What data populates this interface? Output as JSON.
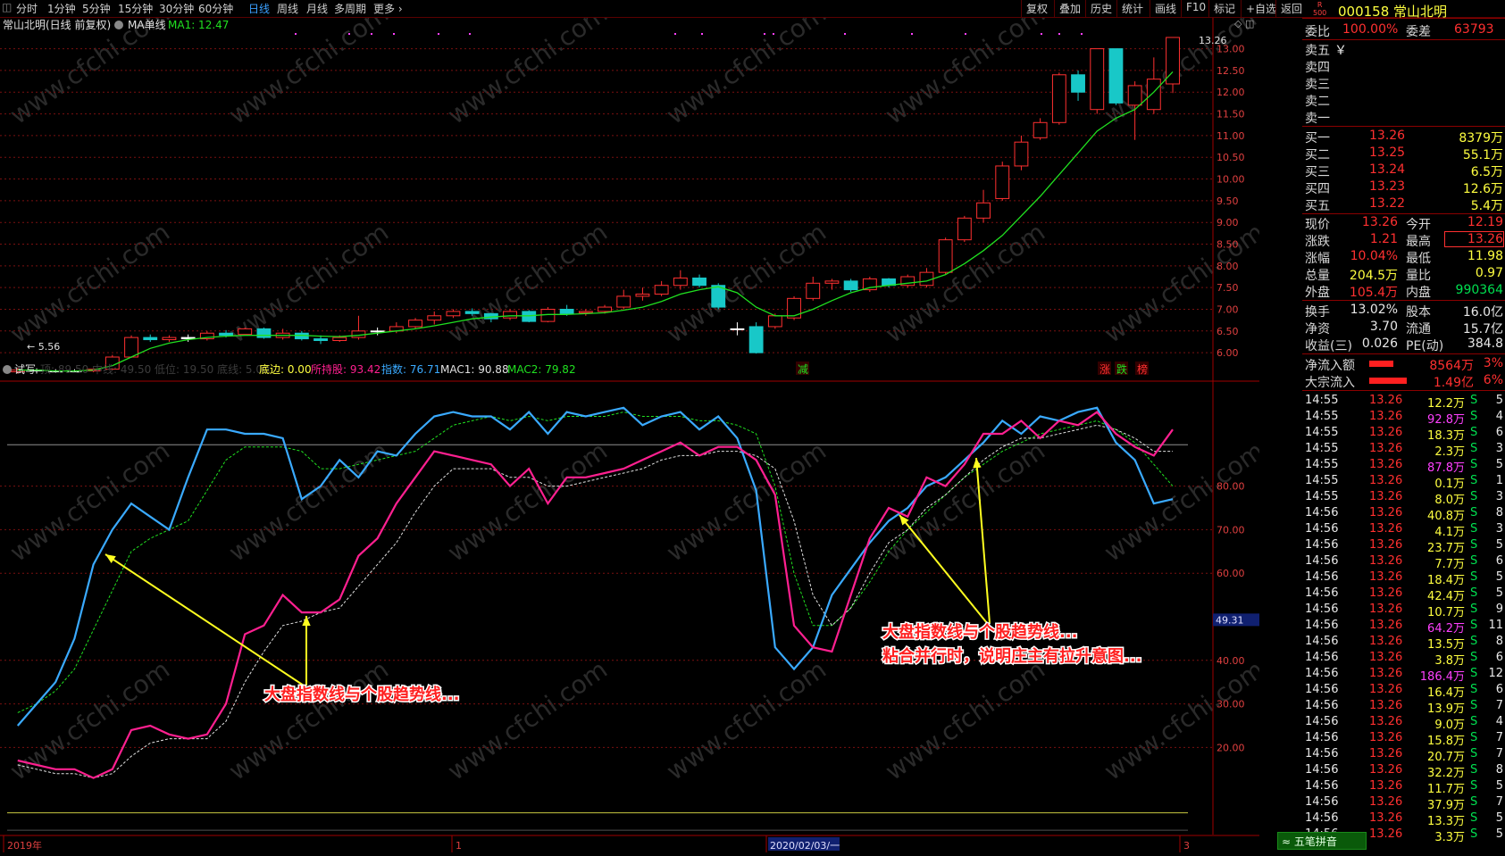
{
  "toolbar": {
    "tabs": [
      "分时",
      "1分钟",
      "5分钟",
      "15分钟",
      "30分钟",
      "60分钟",
      "日线",
      "周线",
      "月线",
      "多周期",
      "更多"
    ],
    "active_tab": "日线",
    "right_buttons": [
      "复权",
      "叠加",
      "历史",
      "统计",
      "画线",
      "F10",
      "标记",
      "+自选",
      "返回"
    ]
  },
  "stock": {
    "code": "000158",
    "name": "常山北明",
    "badge_top": "R",
    "badge_bottom": "500"
  },
  "main_chart": {
    "title": "常山北明(日线 前复权)",
    "indicator_name": "MA单线",
    "ma_label": "MA1: 12.47",
    "high_marker": "13.26",
    "low_marker": "5.56",
    "y_ticks": [
      "13.00",
      "12.50",
      "12.00",
      "11.50",
      "11.00",
      "10.50",
      "10.00",
      "9.50",
      "9.00",
      "8.50",
      "8.00",
      "7.50",
      "7.00",
      "6.50",
      "6.00"
    ],
    "event_labels": [
      "减",
      "涨",
      "跌",
      "榜"
    ]
  },
  "sub_chart": {
    "name": "试写",
    "legend": [
      {
        "label": "底边: 0.00",
        "color": "#ffff40"
      },
      {
        "label": "所持股: 93.42",
        "color": "#ff2090"
      },
      {
        "label": "指数: 76.71",
        "color": "#3aaaff"
      },
      {
        "label": "MAC1: 90.88",
        "color": "#e0e0e0"
      },
      {
        "label": "MAC2: 79.82",
        "color": "#20e020"
      }
    ],
    "faded_legend": "顶: 89.50  中线: 49.50  低位: 19.50  底线: 5.00",
    "y_ticks": [
      "80.00",
      "70.00",
      "60.00",
      "40.00",
      "30.00",
      "20.00"
    ],
    "cursor_value": "49.31",
    "annotation_left": "大盘指数线与个股趋势线...",
    "annotation_right_1": "大盘指数线与个股趋势线...",
    "annotation_right_2": "粘合并行时，说明庄主有拉升意图..."
  },
  "x_axis": {
    "labels": [
      "2019年",
      "1",
      "2020/02/03/一",
      "3"
    ]
  },
  "watermark": "www.cfchi.com",
  "quote": {
    "weibi_label": "委比",
    "weibi_value": "100.00%",
    "weicha_label": "委差",
    "weicha_value": "63793",
    "sell": [
      {
        "label": "卖五",
        "price": "￥",
        "vol": ""
      },
      {
        "label": "卖四",
        "price": "",
        "vol": ""
      },
      {
        "label": "卖三",
        "price": "",
        "vol": ""
      },
      {
        "label": "卖二",
        "price": "",
        "vol": ""
      },
      {
        "label": "卖一",
        "price": "",
        "vol": ""
      }
    ],
    "buy": [
      {
        "label": "买一",
        "price": "13.26",
        "vol": "8379万"
      },
      {
        "label": "买二",
        "price": "13.25",
        "vol": "55.1万"
      },
      {
        "label": "买三",
        "price": "13.24",
        "vol": "6.5万"
      },
      {
        "label": "买四",
        "price": "13.23",
        "vol": "12.6万"
      },
      {
        "label": "买五",
        "price": "13.22",
        "vol": "5.4万"
      }
    ],
    "stats": [
      {
        "l1": "现价",
        "v1": "13.26",
        "c1": "red",
        "l2": "今开",
        "v2": "12.19",
        "c2": "red"
      },
      {
        "l1": "涨跌",
        "v1": "1.21",
        "c1": "red",
        "l2": "最高",
        "v2": "13.26",
        "c2": "red"
      },
      {
        "l1": "涨幅",
        "v1": "10.04%",
        "c1": "red",
        "l2": "最低",
        "v2": "11.98",
        "c2": "yel"
      },
      {
        "l1": "总量",
        "v1": "204.5万",
        "c1": "yel",
        "l2": "量比",
        "v2": "0.97",
        "c2": "yel"
      },
      {
        "l1": "外盘",
        "v1": "105.4万",
        "c1": "red",
        "l2": "内盘",
        "v2": "990364",
        "c2": "grn"
      }
    ],
    "fund": [
      {
        "l1": "换手",
        "v1": "13.02%",
        "l2": "股本",
        "v2": "16.0亿"
      },
      {
        "l1": "净资",
        "v1": "3.70",
        "l2": "流通",
        "v2": "15.7亿"
      },
      {
        "l1": "收益(三)",
        "v1": "0.026",
        "l2": "PE(动)",
        "v2": "384.8"
      }
    ],
    "flow": [
      {
        "label": "净流入额",
        "value": "8564万",
        "pct": "3%"
      },
      {
        "label": "大宗流入",
        "value": "1.49亿",
        "pct": "6%"
      }
    ]
  },
  "ticks": [
    {
      "t": "14:55",
      "p": "13.26",
      "v": "12.2万",
      "s": "S",
      "n": "5"
    },
    {
      "t": "14:55",
      "p": "13.26",
      "v": "92.8万",
      "s": "S",
      "n": "4"
    },
    {
      "t": "14:55",
      "p": "13.26",
      "v": "18.3万",
      "s": "S",
      "n": "6"
    },
    {
      "t": "14:55",
      "p": "13.26",
      "v": "2.3万",
      "s": "S",
      "n": "3"
    },
    {
      "t": "14:55",
      "p": "13.26",
      "v": "87.8万",
      "s": "S",
      "n": "5"
    },
    {
      "t": "14:55",
      "p": "13.26",
      "v": "0.1万",
      "s": "S",
      "n": "1"
    },
    {
      "t": "14:55",
      "p": "13.26",
      "v": "8.0万",
      "s": "S",
      "n": "3"
    },
    {
      "t": "14:56",
      "p": "13.26",
      "v": "40.8万",
      "s": "S",
      "n": "8"
    },
    {
      "t": "14:56",
      "p": "13.26",
      "v": "4.1万",
      "s": "S",
      "n": "3"
    },
    {
      "t": "14:56",
      "p": "13.26",
      "v": "23.7万",
      "s": "S",
      "n": "5"
    },
    {
      "t": "14:56",
      "p": "13.26",
      "v": "7.7万",
      "s": "S",
      "n": "6"
    },
    {
      "t": "14:56",
      "p": "13.26",
      "v": "18.4万",
      "s": "S",
      "n": "5"
    },
    {
      "t": "14:56",
      "p": "13.26",
      "v": "42.4万",
      "s": "S",
      "n": "5"
    },
    {
      "t": "14:56",
      "p": "13.26",
      "v": "10.7万",
      "s": "S",
      "n": "9"
    },
    {
      "t": "14:56",
      "p": "13.26",
      "v": "64.2万",
      "s": "S",
      "n": "11"
    },
    {
      "t": "14:56",
      "p": "13.26",
      "v": "13.5万",
      "s": "S",
      "n": "8"
    },
    {
      "t": "14:56",
      "p": "13.26",
      "v": "3.8万",
      "s": "S",
      "n": "6"
    },
    {
      "t": "14:56",
      "p": "13.26",
      "v": "186.4万",
      "s": "S",
      "n": "12"
    },
    {
      "t": "14:56",
      "p": "13.26",
      "v": "16.4万",
      "s": "S",
      "n": "6"
    },
    {
      "t": "14:56",
      "p": "13.26",
      "v": "13.9万",
      "s": "S",
      "n": "7"
    },
    {
      "t": "14:56",
      "p": "13.26",
      "v": "9.0万",
      "s": "S",
      "n": "4"
    },
    {
      "t": "14:56",
      "p": "13.26",
      "v": "15.8万",
      "s": "S",
      "n": "7"
    },
    {
      "t": "14:56",
      "p": "13.26",
      "v": "20.7万",
      "s": "S",
      "n": "7"
    },
    {
      "t": "14:56",
      "p": "13.26",
      "v": "32.2万",
      "s": "S",
      "n": "8"
    },
    {
      "t": "14:56",
      "p": "13.26",
      "v": "11.7万",
      "s": "S",
      "n": "5"
    },
    {
      "t": "14:56",
      "p": "13.26",
      "v": "37.9万",
      "s": "S",
      "n": "7"
    },
    {
      "t": "14:56",
      "p": "13.26",
      "v": "13.3万",
      "s": "S",
      "n": "5"
    },
    {
      "t": "14:56",
      "p": "13.26",
      "v": "3.3万",
      "s": "S",
      "n": "5"
    }
  ],
  "bottom_button": "五笔拼音",
  "chart_data": {
    "type": "candlestick",
    "price_ylim": [
      5.9,
      13.3
    ],
    "candles": [
      [
        5.56,
        5.6,
        5.52,
        5.65
      ],
      [
        5.6,
        5.58,
        5.52,
        5.64
      ],
      [
        5.58,
        5.58,
        5.54,
        5.62
      ],
      [
        5.58,
        5.58,
        5.55,
        5.62
      ],
      [
        5.58,
        5.62,
        5.55,
        5.65
      ],
      [
        5.62,
        5.9,
        5.6,
        5.95
      ],
      [
        5.9,
        6.35,
        5.88,
        6.4
      ],
      [
        6.35,
        6.3,
        6.25,
        6.42
      ],
      [
        6.3,
        6.35,
        6.25,
        6.4
      ],
      [
        6.35,
        6.32,
        6.25,
        6.42
      ],
      [
        6.32,
        6.45,
        6.28,
        6.5
      ],
      [
        6.45,
        6.4,
        6.35,
        6.52
      ],
      [
        6.42,
        6.55,
        6.4,
        6.58
      ],
      [
        6.55,
        6.35,
        6.32,
        6.58
      ],
      [
        6.35,
        6.45,
        6.3,
        6.55
      ],
      [
        6.45,
        6.32,
        6.28,
        6.5
      ],
      [
        6.32,
        6.28,
        6.2,
        6.4
      ],
      [
        6.28,
        6.35,
        6.25,
        6.4
      ],
      [
        6.35,
        6.5,
        6.3,
        6.85
      ],
      [
        6.5,
        6.5,
        6.4,
        6.58
      ],
      [
        6.5,
        6.6,
        6.45,
        6.7
      ],
      [
        6.6,
        6.75,
        6.55,
        6.8
      ],
      [
        6.75,
        6.85,
        6.65,
        6.95
      ],
      [
        6.85,
        6.95,
        6.8,
        7.0
      ],
      [
        6.95,
        6.9,
        6.85,
        7.02
      ],
      [
        6.9,
        6.78,
        6.7,
        6.92
      ],
      [
        6.8,
        6.95,
        6.75,
        7.0
      ],
      [
        6.95,
        6.72,
        6.7,
        6.98
      ],
      [
        6.72,
        7.0,
        6.7,
        7.05
      ],
      [
        7.0,
        6.9,
        6.85,
        7.1
      ],
      [
        6.92,
        6.95,
        6.85,
        7.0
      ],
      [
        6.95,
        7.05,
        6.9,
        7.1
      ],
      [
        7.05,
        7.3,
        7.0,
        7.45
      ],
      [
        7.3,
        7.35,
        7.2,
        7.5
      ],
      [
        7.35,
        7.55,
        7.3,
        7.65
      ],
      [
        7.55,
        7.72,
        7.45,
        7.9
      ],
      [
        7.72,
        7.55,
        7.5,
        7.8
      ],
      [
        7.55,
        7.05,
        7.0,
        7.6
      ],
      [
        6.55,
        6.55,
        6.4,
        6.7
      ],
      [
        6.6,
        6.0,
        5.98,
        6.7
      ],
      [
        6.6,
        6.85,
        6.55,
        6.9
      ],
      [
        6.8,
        7.25,
        6.75,
        7.3
      ],
      [
        7.25,
        7.6,
        7.2,
        7.75
      ],
      [
        7.6,
        7.65,
        7.45,
        7.7
      ],
      [
        7.65,
        7.45,
        7.4,
        7.7
      ],
      [
        7.45,
        7.7,
        7.4,
        7.75
      ],
      [
        7.7,
        7.55,
        7.5,
        7.72
      ],
      [
        7.55,
        7.75,
        7.5,
        7.8
      ],
      [
        7.55,
        7.85,
        7.5,
        7.95
      ],
      [
        7.85,
        8.6,
        7.8,
        8.65
      ],
      [
        8.6,
        9.1,
        8.55,
        9.15
      ],
      [
        9.1,
        9.45,
        9.0,
        9.75
      ],
      [
        9.55,
        10.3,
        9.5,
        10.4
      ],
      [
        10.3,
        10.85,
        10.2,
        11.0
      ],
      [
        10.95,
        11.3,
        10.9,
        11.4
      ],
      [
        11.3,
        12.4,
        11.25,
        12.45
      ],
      [
        12.4,
        12.0,
        11.8,
        12.5
      ],
      [
        11.6,
        13.0,
        11.5,
        13.0
      ],
      [
        13.0,
        11.75,
        11.7,
        13.0
      ],
      [
        11.7,
        12.15,
        10.9,
        12.25
      ],
      [
        11.6,
        12.3,
        11.5,
        12.8
      ],
      [
        12.19,
        13.26,
        11.98,
        13.26
      ]
    ],
    "ma": [
      5.6,
      5.6,
      5.58,
      5.58,
      5.6,
      5.7,
      5.9,
      6.1,
      6.22,
      6.3,
      6.35,
      6.38,
      6.4,
      6.4,
      6.4,
      6.4,
      6.38,
      6.37,
      6.4,
      6.45,
      6.5,
      6.55,
      6.62,
      6.7,
      6.78,
      6.82,
      6.85,
      6.85,
      6.88,
      6.88,
      6.9,
      6.92,
      6.98,
      7.05,
      7.18,
      7.35,
      7.45,
      7.52,
      7.38,
      7.05,
      6.85,
      6.85,
      7.0,
      7.2,
      7.38,
      7.5,
      7.55,
      7.6,
      7.65,
      7.8,
      8.05,
      8.35,
      8.7,
      9.15,
      9.6,
      10.1,
      10.6,
      11.1,
      11.4,
      11.6,
      12.0,
      12.47
    ],
    "sub_ylim": [
      0,
      100
    ],
    "stock_line": [
      17,
      16,
      15,
      15,
      13,
      15,
      24,
      25,
      23,
      22,
      23,
      30,
      46,
      48,
      55,
      51,
      51,
      54,
      64,
      68,
      76,
      82,
      88,
      87,
      86,
      85,
      80,
      84,
      76,
      82,
      82,
      83,
      84,
      86,
      88,
      90,
      87,
      89,
      89,
      86,
      78,
      48,
      43,
      42,
      55,
      68,
      75,
      73,
      82,
      80,
      85,
      92,
      92,
      95,
      91,
      95,
      94,
      97,
      92,
      89,
      87,
      93
    ],
    "index_line": [
      25,
      30,
      35,
      45,
      62,
      70,
      76,
      73,
      70,
      82,
      93,
      93,
      92,
      92,
      91,
      77,
      80,
      86,
      82,
      88,
      87,
      92,
      96,
      97,
      96,
      96,
      93,
      97,
      92,
      97,
      96,
      97,
      98,
      94,
      96,
      97,
      93,
      96,
      91,
      79,
      43,
      38,
      43,
      55,
      61,
      67,
      72,
      75,
      80,
      82,
      86,
      90,
      95,
      92,
      96,
      95,
      97,
      98,
      90,
      86,
      76,
      77
    ],
    "mac1": [
      16,
      15,
      14,
      14,
      13,
      14,
      18,
      21,
      22,
      22,
      22,
      26,
      35,
      42,
      48,
      49,
      51,
      52,
      57,
      62,
      67,
      74,
      80,
      84,
      84,
      84,
      82,
      82,
      80,
      80,
      81,
      82,
      83,
      84,
      86,
      87,
      87,
      88,
      88,
      87,
      84,
      72,
      55,
      48,
      52,
      60,
      67,
      70,
      75,
      78,
      82,
      86,
      89,
      91,
      91,
      92,
      93,
      94,
      93,
      91,
      88,
      88
    ],
    "mac2": [
      28,
      30,
      33,
      38,
      47,
      56,
      65,
      68,
      70,
      72,
      79,
      86,
      89,
      89,
      89,
      88,
      84,
      84,
      85,
      86,
      87,
      88,
      91,
      94,
      95,
      96,
      95,
      96,
      95,
      96,
      96,
      96,
      97,
      96,
      96,
      96,
      95,
      95,
      94,
      92,
      80,
      60,
      48,
      48,
      52,
      58,
      65,
      70,
      74,
      78,
      82,
      85,
      88,
      90,
      92,
      93,
      94,
      95,
      93,
      90,
      85,
      80
    ],
    "x_labels": [
      "2019年",
      "1",
      "2020/02/03/一",
      "3"
    ]
  },
  "colors": {
    "up": "#ff3030",
    "down": "#18c8c8",
    "ma": "#20e020",
    "stock_line": "#ff2090",
    "index_line": "#3aaaff",
    "grid": "#7a1010",
    "annotation_arrow": "#ffff20",
    "annotation_text": "#ff2020"
  }
}
